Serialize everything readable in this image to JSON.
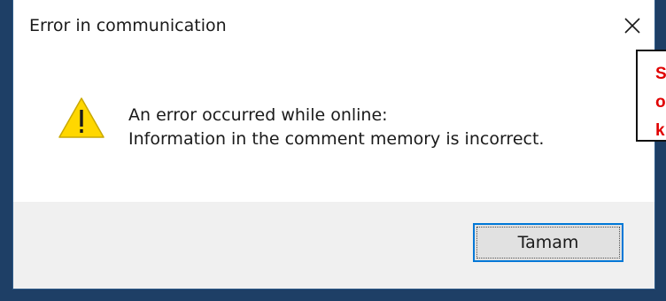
{
  "dialog": {
    "title": "Error in communication",
    "message_line1": "An error occurred while online:",
    "message_line2": "Information in the comment memory is incorrect.",
    "ok_label": "Tamam",
    "icons": {
      "warning": "warning-icon",
      "close": "close-icon"
    }
  },
  "overlay_note": {
    "lines": [
      "S",
      "o",
      "k"
    ]
  },
  "colors": {
    "accent": "#0078d7",
    "warning_fill": "#ffd700",
    "note_text": "#e00000"
  }
}
